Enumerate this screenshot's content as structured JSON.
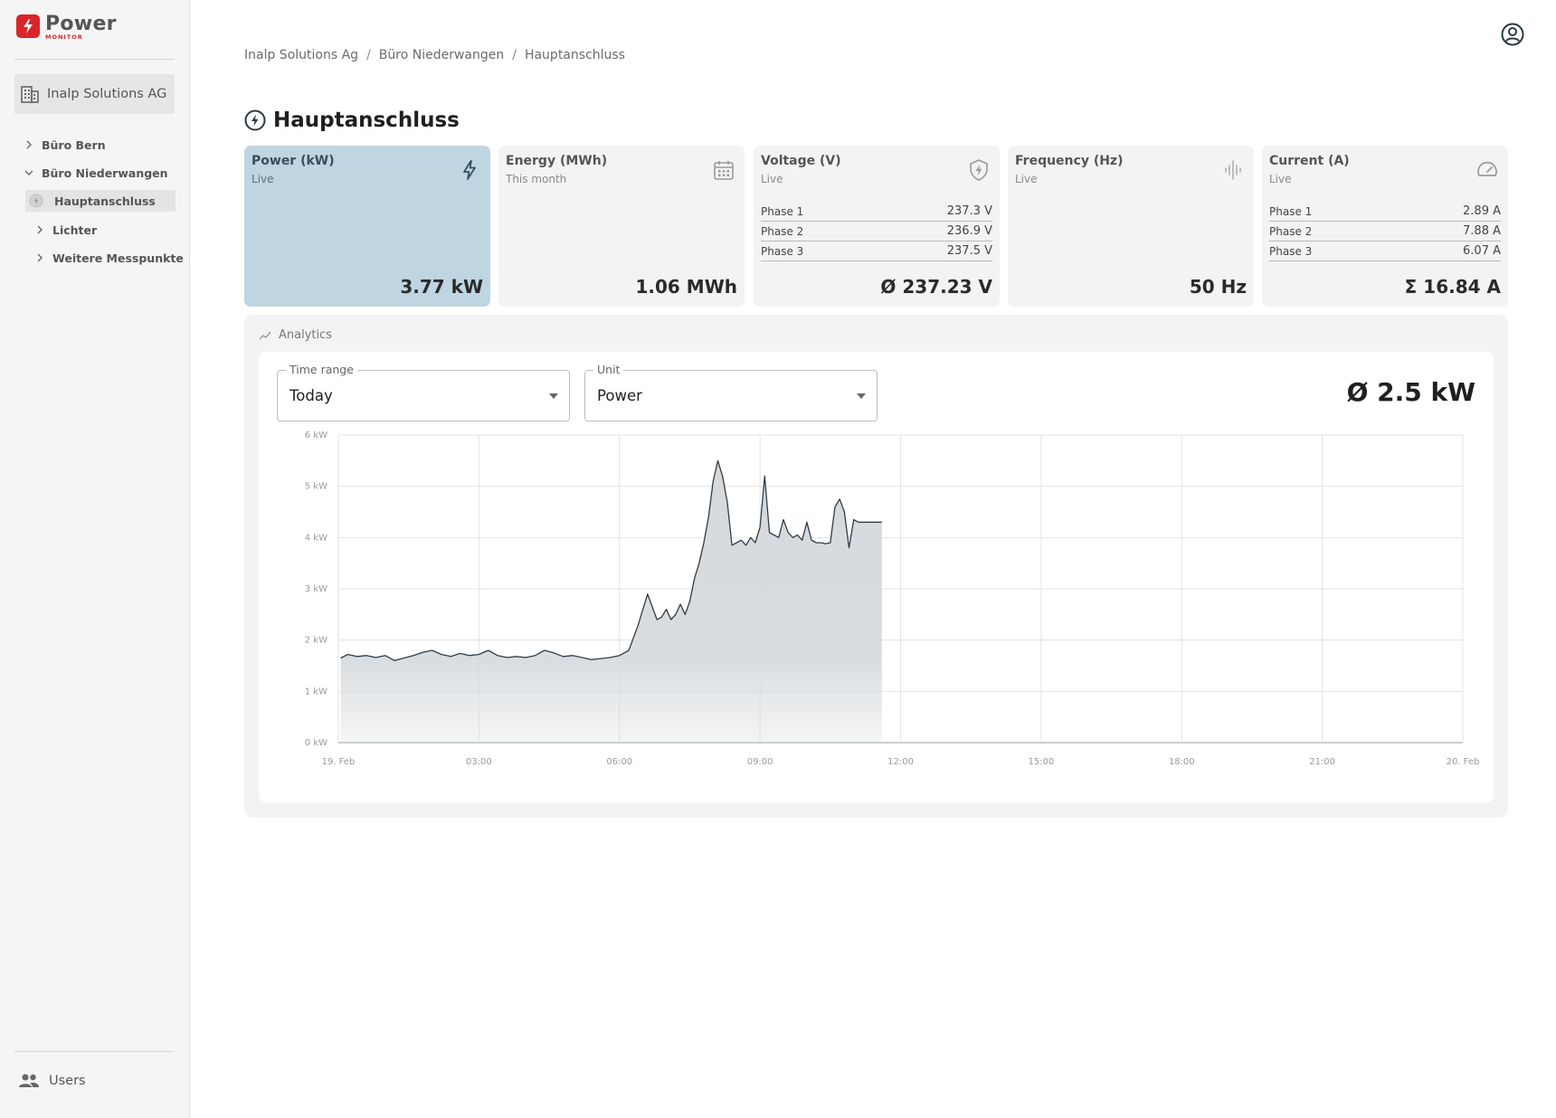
{
  "logo": {
    "title": "Power",
    "subtitle": "MONITOR"
  },
  "sidebar": {
    "org_label": "Inalp Solutions AG",
    "tree": [
      {
        "label": "Büro Bern",
        "expanded": false
      },
      {
        "label": "Büro Niederwangen",
        "expanded": true
      },
      {
        "label": "Hauptanschluss",
        "active": true
      },
      {
        "label": "Lichter",
        "expanded": false
      },
      {
        "label": "Weitere Messpunkte",
        "expanded": false
      }
    ],
    "users_label": "Users"
  },
  "breadcrumb": [
    "Inalp Solutions Ag",
    "Büro Niederwangen",
    "Hauptanschluss"
  ],
  "page": {
    "title": "Hauptanschluss"
  },
  "cards": {
    "power": {
      "title": "Power (kW)",
      "sub": "Live",
      "value": "3.77 kW",
      "icon": "bolt-icon"
    },
    "energy": {
      "title": "Energy (MWh)",
      "sub": "This month",
      "value": "1.06 MWh",
      "icon": "calendar-icon"
    },
    "voltage": {
      "title": "Voltage (V)",
      "sub": "Live",
      "value": "Ø 237.23 V",
      "icon": "shield-bolt-icon",
      "phases": [
        {
          "label": "Phase 1",
          "value": "237.3 V"
        },
        {
          "label": "Phase 2",
          "value": "236.9 V"
        },
        {
          "label": "Phase 3",
          "value": "237.5 V"
        }
      ]
    },
    "frequency": {
      "title": "Frequency (Hz)",
      "sub": "Live",
      "value": "50 Hz",
      "icon": "waveform-icon"
    },
    "current": {
      "title": "Current (A)",
      "sub": "Live",
      "value": "Σ 16.84 A",
      "icon": "gauge-icon",
      "phases": [
        {
          "label": "Phase 1",
          "value": "2.89 A"
        },
        {
          "label": "Phase 2",
          "value": "7.88 A"
        },
        {
          "label": "Phase 3",
          "value": "6.07 A"
        }
      ]
    }
  },
  "analytics": {
    "heading": "Analytics",
    "time_range": {
      "label": "Time range",
      "value": "Today"
    },
    "unit": {
      "label": "Unit",
      "value": "Power"
    },
    "average": "Ø 2.5 kW"
  },
  "colors": {
    "accent": "#d9252a",
    "active_card": "#bfd5e1",
    "line": "#2f3d47",
    "fill": "#d5d9dc"
  },
  "chart_data": {
    "type": "area",
    "y_ticks": [
      "0 kW",
      "1 kW",
      "2 kW",
      "3 kW",
      "4 kW",
      "5 kW",
      "6 kW"
    ],
    "ylim": [
      0,
      6
    ],
    "x_ticks": [
      "19. Feb",
      "03:00",
      "06:00",
      "09:00",
      "12:00",
      "15:00",
      "18:00",
      "21:00",
      "20. Feb"
    ],
    "xlim_hours": [
      0,
      24
    ],
    "grid": true,
    "series": [
      {
        "x": [
          0.05,
          0.2,
          0.4,
          0.6,
          0.8,
          1.0,
          1.2,
          1.4,
          1.6,
          1.8,
          2.0,
          2.2,
          2.4,
          2.6,
          2.8,
          3.0,
          3.2,
          3.4,
          3.6,
          3.8,
          4.0,
          4.2,
          4.4,
          4.6,
          4.8,
          5.0,
          5.2,
          5.4,
          5.6,
          5.8,
          6.0,
          6.2,
          6.4,
          6.6,
          6.8,
          6.9,
          7.0,
          7.1,
          7.2,
          7.3,
          7.4,
          7.5,
          7.6,
          7.7,
          7.8,
          7.9,
          8.0,
          8.1,
          8.2,
          8.3,
          8.4,
          8.5,
          8.6,
          8.7,
          8.8,
          8.9,
          9.0,
          9.1,
          9.2,
          9.3,
          9.4,
          9.5,
          9.6,
          9.7,
          9.8,
          9.9,
          10.0,
          10.1,
          10.2,
          10.3,
          10.4,
          10.5,
          10.6,
          10.7,
          10.8,
          10.9,
          11.0,
          11.1,
          11.2,
          11.3,
          11.4,
          11.5,
          11.6
        ],
        "y": [
          1.65,
          1.72,
          1.68,
          1.7,
          1.66,
          1.7,
          1.6,
          1.65,
          1.7,
          1.76,
          1.8,
          1.72,
          1.68,
          1.74,
          1.7,
          1.72,
          1.8,
          1.7,
          1.66,
          1.68,
          1.66,
          1.7,
          1.8,
          1.75,
          1.68,
          1.7,
          1.66,
          1.62,
          1.64,
          1.66,
          1.7,
          1.8,
          2.3,
          2.9,
          2.4,
          2.45,
          2.6,
          2.4,
          2.5,
          2.7,
          2.5,
          2.75,
          3.2,
          3.5,
          3.9,
          4.4,
          5.1,
          5.5,
          5.2,
          4.7,
          3.85,
          3.9,
          3.95,
          3.85,
          4.0,
          3.9,
          4.2,
          5.2,
          4.1,
          4.05,
          4.0,
          4.35,
          4.1,
          4.0,
          4.05,
          3.95,
          4.3,
          3.95,
          3.9,
          3.9,
          3.88,
          3.9,
          4.6,
          4.75,
          4.5,
          3.8,
          4.35,
          4.3,
          4.3,
          4.3,
          4.3,
          4.3,
          4.3
        ]
      }
    ]
  }
}
